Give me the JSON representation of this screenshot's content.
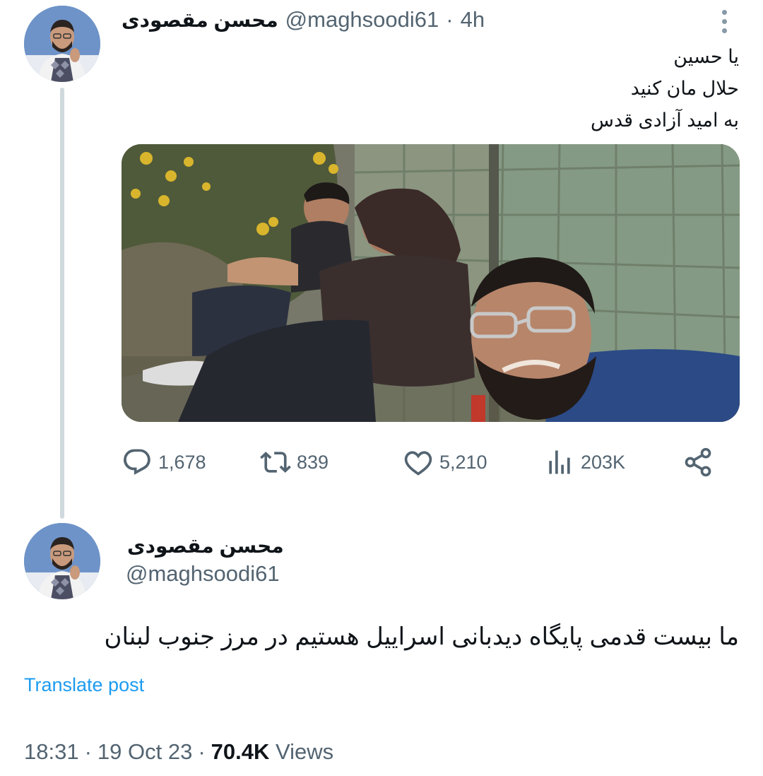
{
  "tweet1": {
    "author_name": "محسن مقصودی",
    "handle": "@maghsoodi61",
    "separator": "·",
    "time": "4h",
    "lines": [
      "یا حسین",
      "حلال مان کنید",
      "به امید آزادی قدس"
    ],
    "actions": {
      "replies": "1,678",
      "retweets": "839",
      "likes": "5,210",
      "views": "203K"
    }
  },
  "tweet2": {
    "author_name": "محسن مقصودی",
    "handle": "@maghsoodi61",
    "text": "ما بیست قدمی پایگاه دیدبانی اسراییل هستیم در مرز جنوب لبنان",
    "translate_label": "Translate post",
    "timestamp": "18:31",
    "date": "19 Oct 23",
    "separator": "·",
    "views_count": "70.4K",
    "views_label": "Views"
  },
  "colors": {
    "accent": "#1d9bf0",
    "secondary_text": "#536471",
    "primary_text": "#0f1419",
    "thread_line": "#cfd9de"
  },
  "icons": {
    "more": "more-vertical-icon",
    "reply": "reply-icon",
    "retweet": "retweet-icon",
    "like": "heart-icon",
    "views": "views-bar-icon",
    "share": "share-icon"
  }
}
